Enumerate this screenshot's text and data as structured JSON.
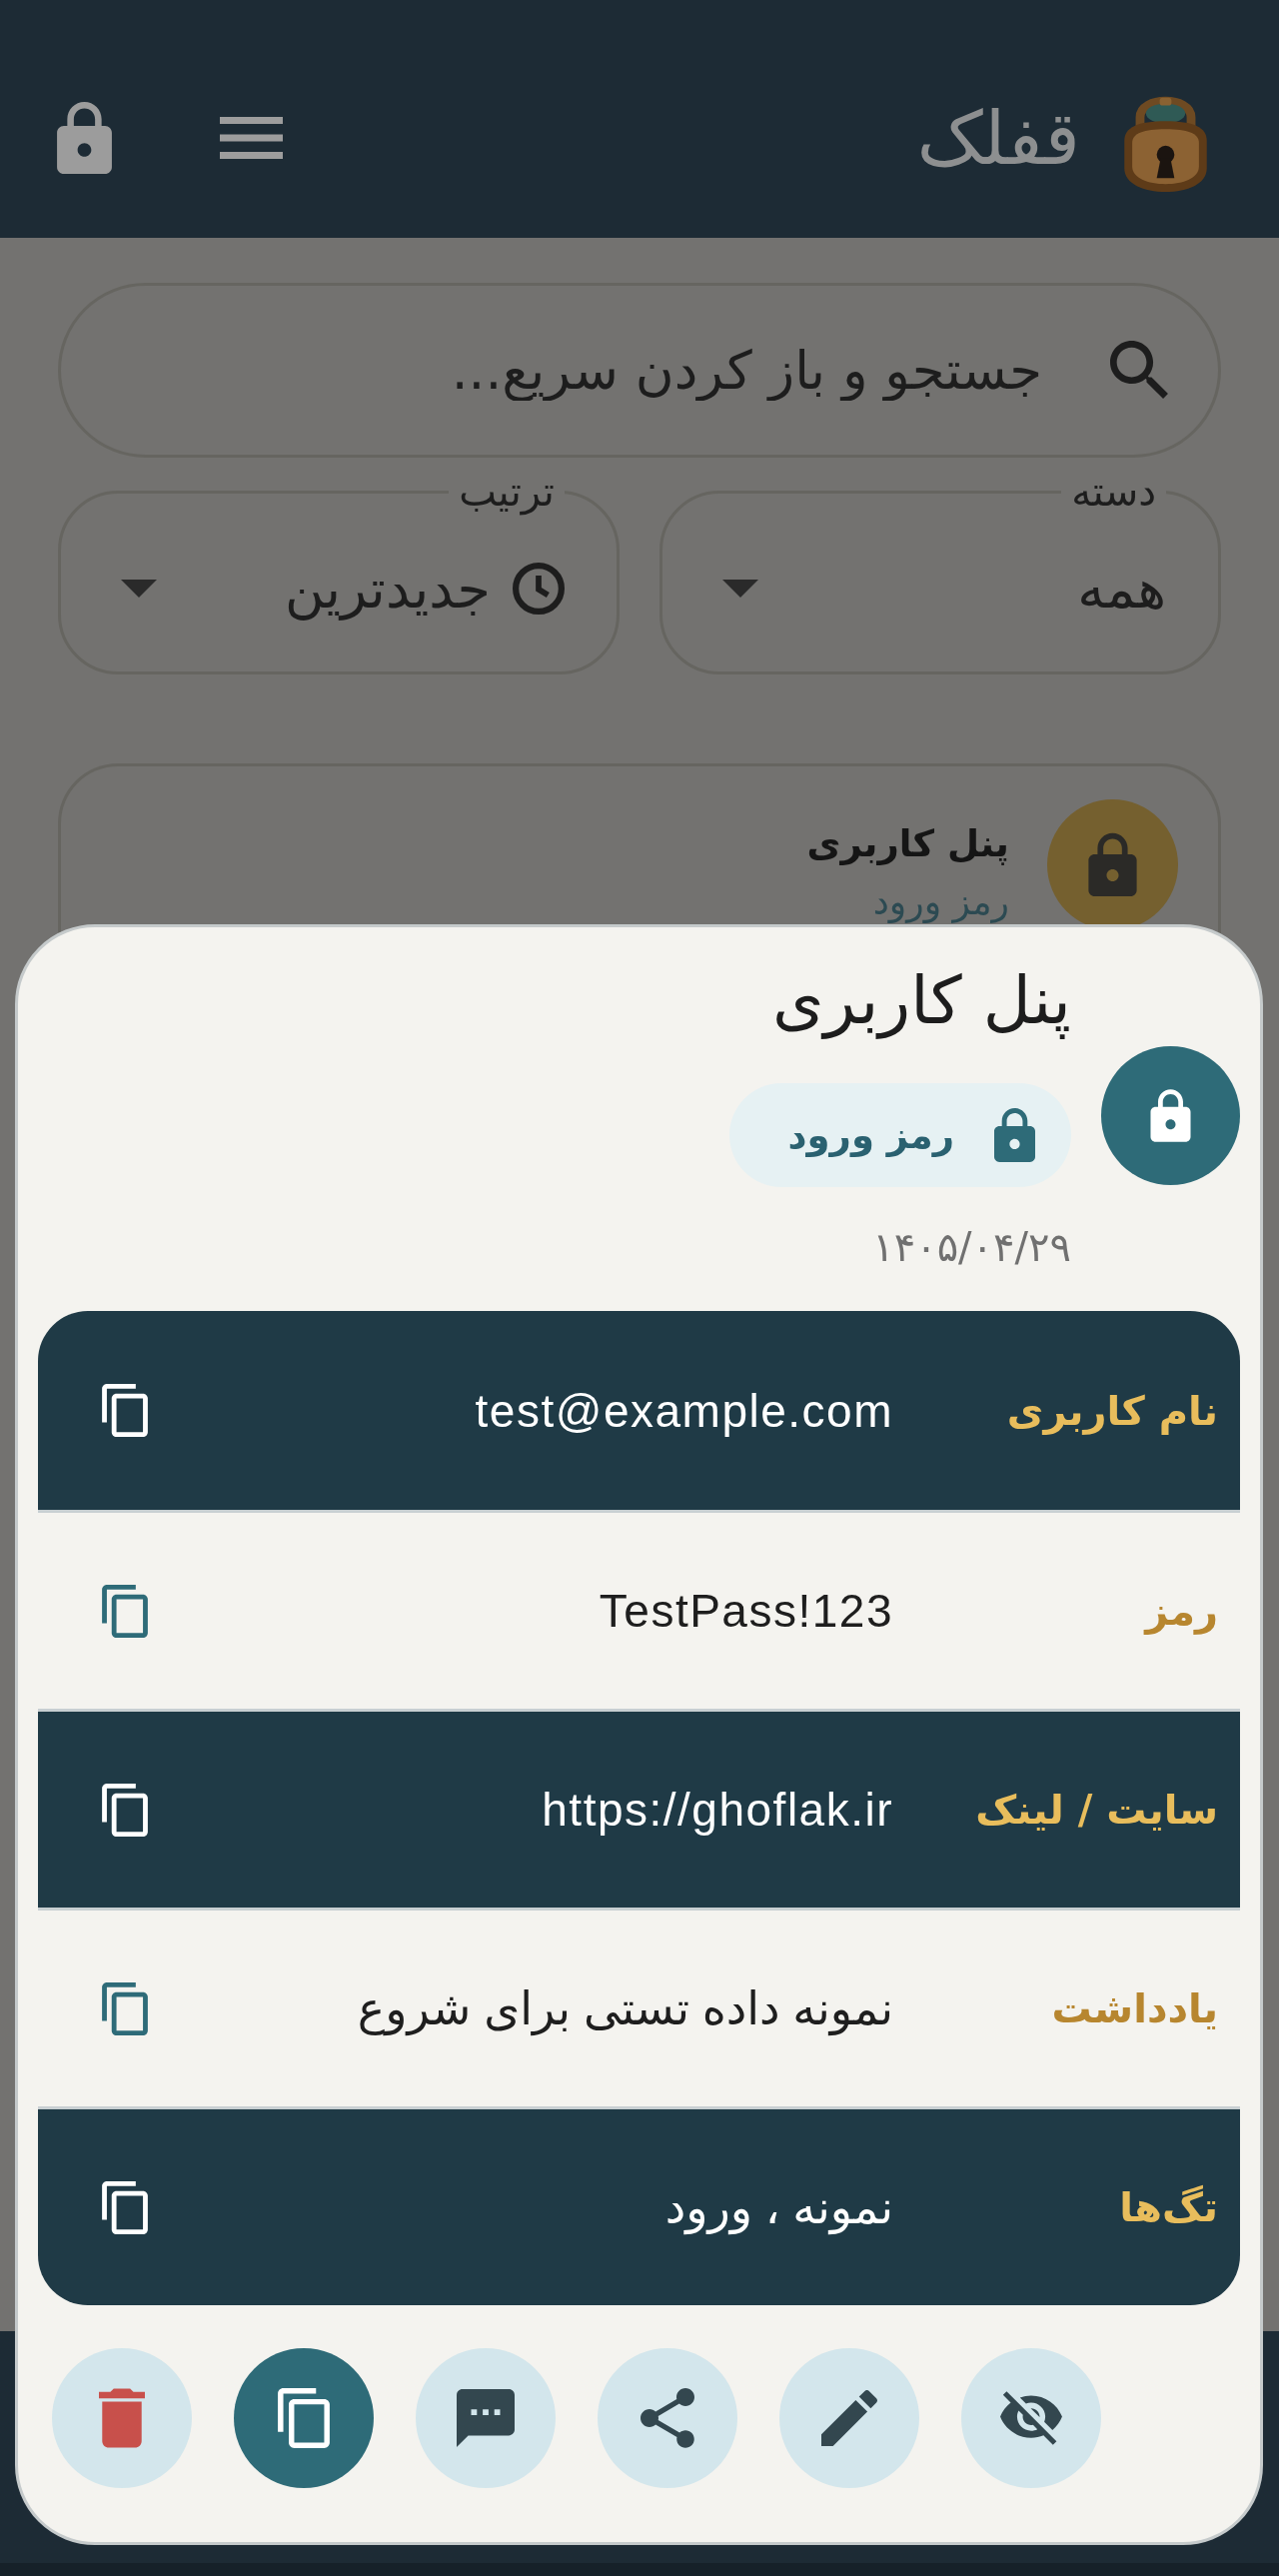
{
  "app_bar": {
    "title": "قفلک"
  },
  "search": {
    "placeholder": "جستجو و باز کردن سریع..."
  },
  "filters": [
    {
      "kind": "category",
      "label": "دسته",
      "value": "همه"
    },
    {
      "kind": "sort",
      "label": "ترتیب",
      "value": "جدیدترین"
    }
  ],
  "entries": [
    {
      "title": "پنل کاربری",
      "subtitle": "رمز ورود"
    }
  ],
  "detail": {
    "title": "پنل کاربری",
    "type": "رمز ورود",
    "date": "۱۴۰۵/۰۴/۲۹",
    "fields": [
      {
        "label": "نام کاربری",
        "value": "test@example.com"
      },
      {
        "label": "رمز",
        "value": "TestPass!123"
      },
      {
        "label": "سایت / لینک",
        "value": "https://ghoflak.ir"
      },
      {
        "label": "یادداشت",
        "value": "نمونه داده تستی برای شروع"
      },
      {
        "label": "تگ‌ها",
        "value": "نمونه ، ورود"
      }
    ],
    "actions": [
      {
        "kind": "hide",
        "primary": false
      },
      {
        "kind": "edit",
        "primary": false
      },
      {
        "kind": "share",
        "primary": false
      },
      {
        "kind": "comment",
        "primary": false
      },
      {
        "kind": "copy",
        "primary": true
      },
      {
        "kind": "delete",
        "primary": false
      }
    ]
  }
}
